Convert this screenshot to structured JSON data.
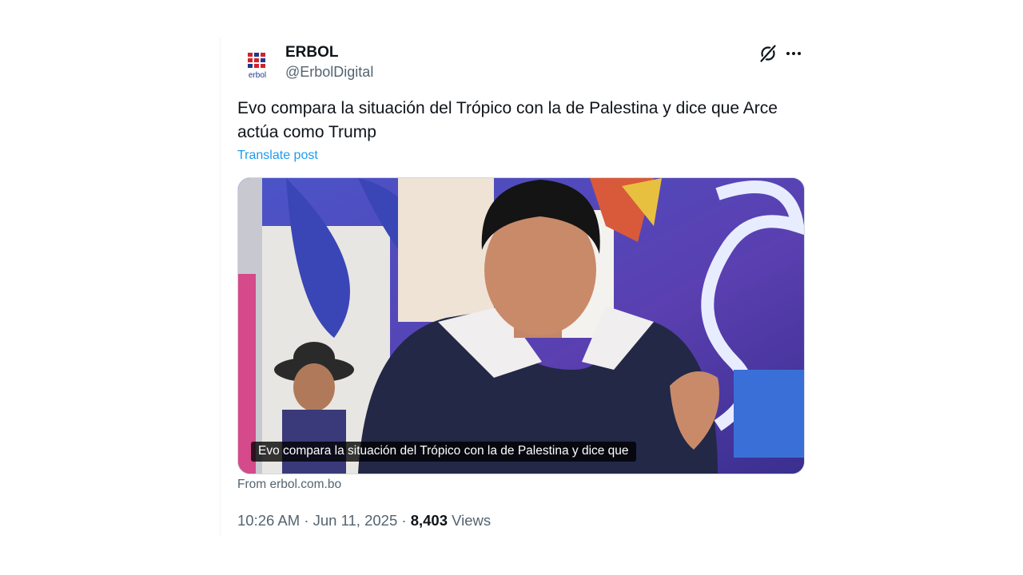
{
  "author": {
    "display_name": "ERBOL",
    "handle": "@ErbolDigital",
    "avatar_text": "erbol",
    "avatar_colors": {
      "red": "#d3222c",
      "blue": "#1e3a8c"
    }
  },
  "actions": {
    "grok_icon": "grok-icon",
    "more_icon": "more-icon"
  },
  "post": {
    "text": "Evo compara la situación del Trópico con la de Palestina y dice que Arce actúa como Trump",
    "translate_label": "Translate post"
  },
  "media": {
    "caption": "Evo compara la situación del Trópico con la de Palestina y dice que",
    "source_label": "From erbol.com.bo"
  },
  "meta": {
    "time": "10:26 AM",
    "separator": "·",
    "date": "Jun 11, 2025",
    "views_count": "8,403",
    "views_label": "Views"
  },
  "colors": {
    "link": "#1d9bf0",
    "secondary_text": "#536471",
    "primary_text": "#0f1419"
  }
}
